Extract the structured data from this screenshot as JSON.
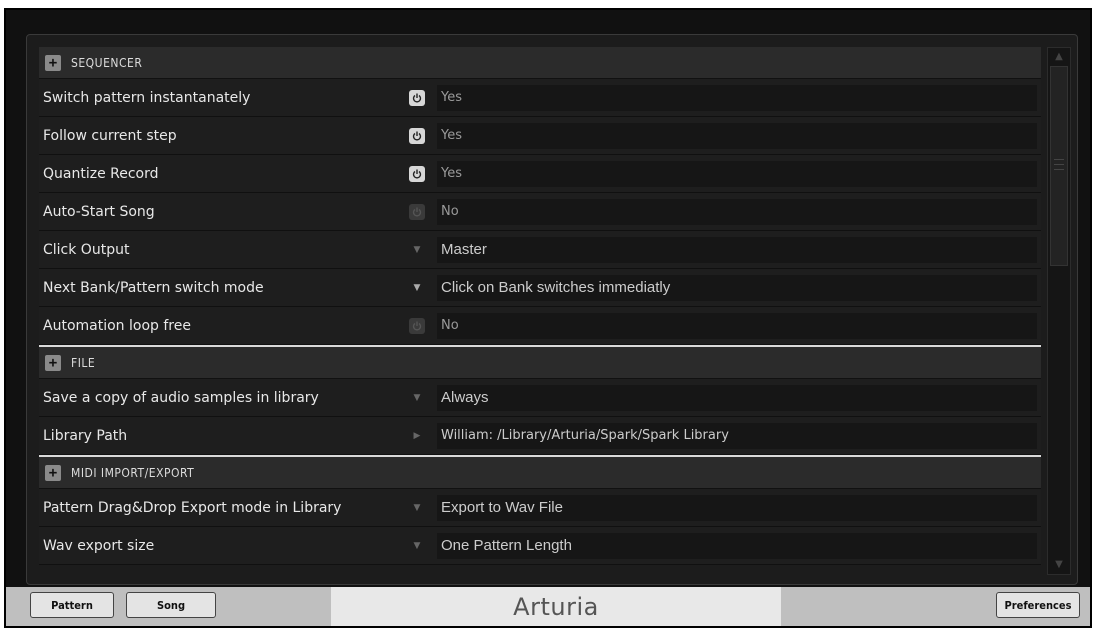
{
  "sections": {
    "sequencer": "SEQUENCER",
    "file": "FILE",
    "midi": "MIDI IMPORT/EXPORT"
  },
  "sequencer_rows": [
    {
      "label": "Switch pattern instantanately",
      "control": "power-on",
      "value": "Yes"
    },
    {
      "label": "Follow current step",
      "control": "power-on",
      "value": "Yes"
    },
    {
      "label": "Quantize Record",
      "control": "power-on",
      "value": "Yes"
    },
    {
      "label": "Auto-Start Song",
      "control": "power-off",
      "value": "No"
    },
    {
      "label": "Click Output",
      "control": "dropdown",
      "value": "Master"
    },
    {
      "label": "Next Bank/Pattern switch mode",
      "control": "dropdown",
      "value": "Click on Bank switches immediatly"
    },
    {
      "label": "Automation loop free",
      "control": "power-off",
      "value": "No"
    }
  ],
  "file_rows": [
    {
      "label": "Save a copy of audio samples in library",
      "control": "dropdown",
      "value": "Always"
    },
    {
      "label": "Library Path",
      "control": "browse",
      "value": "William: /Library/Arturia/Spark/Spark Library"
    }
  ],
  "midi_rows": [
    {
      "label": "Pattern Drag&Drop Export mode in Library",
      "control": "dropdown",
      "value": "Export to Wav File"
    },
    {
      "label": "Wav export size",
      "control": "dropdown",
      "value": "One Pattern Length"
    }
  ],
  "bottom": {
    "pattern": "Pattern",
    "song": "Song",
    "preferences": "Preferences",
    "logo": "Arturia"
  },
  "icons": {
    "section_toggle": "plus-icon",
    "power": "power-icon",
    "dropdown": "triangle-down-icon",
    "browse": "triangle-right-icon"
  }
}
